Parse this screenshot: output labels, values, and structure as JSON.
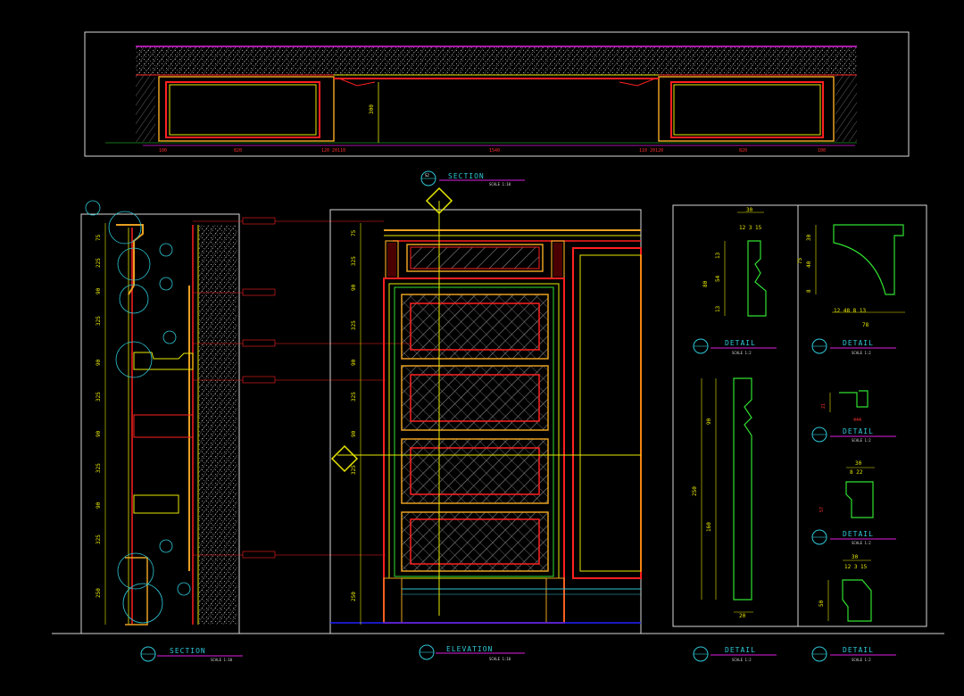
{
  "drawing": {
    "background": "#000000",
    "colors": {
      "frame": "#d9d9d9",
      "red": "#ff2020",
      "yellow": "#e8e800",
      "green": "#30e030",
      "cyan": "#2ec8d8",
      "magenta": "#e020e0",
      "blue": "#2020ff",
      "white": "#ffffff"
    }
  },
  "titles": {
    "section_top": {
      "label": "SECTION",
      "scale": "SCALE 1:10"
    },
    "section_left": {
      "label": "SECTION",
      "scale": "SCALE 1:10"
    },
    "elevation": {
      "label": "ELEVATION",
      "scale": "SCALE 1:10"
    },
    "detail_1": {
      "label": "DETAIL",
      "scale": "SCALE 1:2"
    },
    "detail_2": {
      "label": "DETAIL",
      "scale": "SCALE 1:2"
    },
    "detail_3": {
      "label": "DETAIL",
      "scale": "SCALE 1:2"
    },
    "detail_4": {
      "label": "DETAIL",
      "scale": "SCALE 1:2"
    },
    "detail_5": {
      "label": "DETAIL",
      "scale": "SCALE 1:2"
    },
    "detail_6": {
      "label": "DETAIL",
      "scale": "SCALE 1:2"
    }
  },
  "dimensions": {
    "top_section": [
      "820",
      "1540",
      "820",
      "300"
    ],
    "detail_1": {
      "width": "30",
      "parts": "12 3 15",
      "h1": "13",
      "h2": "54",
      "h3": "13",
      "total": "80"
    },
    "detail_2": {
      "h1": "30",
      "h2": "40",
      "h3": "8",
      "total": "75",
      "parts": "12 48 8 13",
      "width": "78"
    },
    "detail_4": {
      "width": "30",
      "parts": "8 22"
    },
    "detail_5": {
      "width": "30",
      "parts": "12 3 15",
      "h": "50"
    },
    "detail_6": {
      "h1": "90",
      "h2": "160",
      "total": "250",
      "width": "20"
    },
    "elevation_left": [
      "75",
      "325",
      "90",
      "325",
      "90",
      "325",
      "90",
      "325",
      "250"
    ]
  }
}
